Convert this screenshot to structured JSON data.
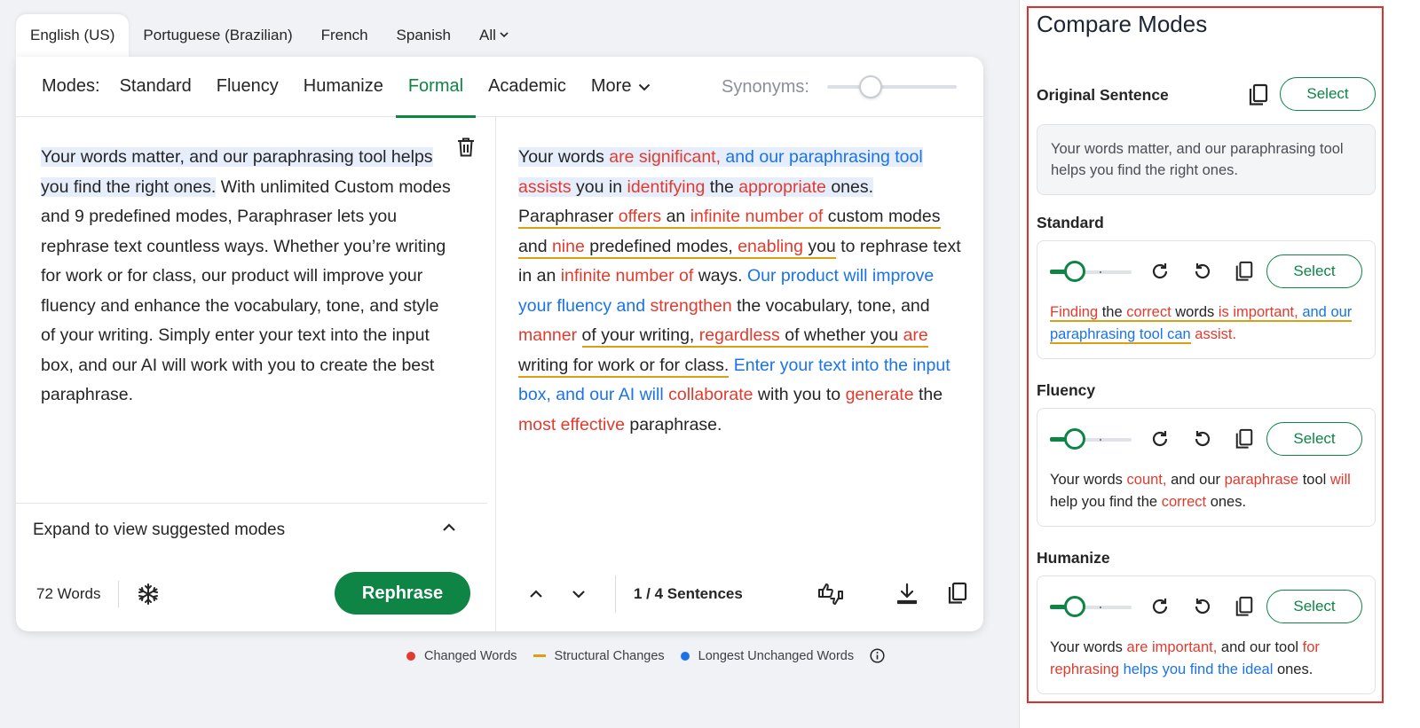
{
  "languages": [
    {
      "label": "English (US)",
      "active": true
    },
    {
      "label": "Portuguese (Brazilian)"
    },
    {
      "label": "French"
    },
    {
      "label": "Spanish"
    },
    {
      "label": "All"
    }
  ],
  "modes": {
    "label": "Modes:",
    "items": [
      "Standard",
      "Fluency",
      "Humanize",
      "Formal",
      "Academic",
      "More"
    ],
    "active": "Formal",
    "synonyms_label": "Synonyms:"
  },
  "input": {
    "sentence1": "Your words matter, and our paraphrasing tool helps you find the right ones.",
    "rest": " With unlimited Custom modes and 9 predefined modes, Paraphraser lets you rephrase text countless ways. Whether you’re writing for work or for class, our product will improve your fluency and enhance the vocabulary, tone, and style of your writing. Simply enter your text into the input box, and our AI will work with you to create the best paraphrase."
  },
  "output": {
    "segments": [
      {
        "t": "Your words ",
        "c": "n",
        "hl": true
      },
      {
        "t": "are significant,",
        "c": "r",
        "hl": true
      },
      {
        "t": " and our paraphrasing tool",
        "c": "b",
        "hl": true
      },
      {
        "t": " ",
        "c": "n",
        "hl": true
      },
      {
        "t": "assists",
        "c": "r",
        "hl": true
      },
      {
        "t": " you in ",
        "c": "n",
        "hl": true
      },
      {
        "t": "identifying",
        "c": "r",
        "hl": true
      },
      {
        "t": " the ",
        "c": "n",
        "hl": true
      },
      {
        "t": "appropriate",
        "c": "r",
        "hl": true
      },
      {
        "t": " ones. ",
        "c": "n",
        "hl": true
      },
      {
        "t": "Paraphraser ",
        "c": "n",
        "ul": true
      },
      {
        "t": "offers",
        "c": "r",
        "ul": true
      },
      {
        "t": " an ",
        "c": "n",
        "ul": true
      },
      {
        "t": "infinite number of",
        "c": "r",
        "ul": true
      },
      {
        "t": " custom modes and ",
        "c": "n",
        "ul": true
      },
      {
        "t": "nine",
        "c": "r",
        "ul": true
      },
      {
        "t": " predefined modes, ",
        "c": "n",
        "ul": true
      },
      {
        "t": "enabling",
        "c": "r",
        "ul": true
      },
      {
        "t": " you",
        "c": "n",
        "ul": true
      },
      {
        "t": " to rephrase text in an ",
        "c": "n"
      },
      {
        "t": "infinite number of",
        "c": "r"
      },
      {
        "t": " ways. ",
        "c": "n"
      },
      {
        "t": "Our product will improve your fluency and",
        "c": "b"
      },
      {
        "t": " ",
        "c": "n"
      },
      {
        "t": "strengthen",
        "c": "r"
      },
      {
        "t": " the vocabulary, tone, and ",
        "c": "n"
      },
      {
        "t": "manner",
        "c": "r"
      },
      {
        "t": " ",
        "c": "n"
      },
      {
        "t": "of your writing, ",
        "c": "n",
        "ul": true
      },
      {
        "t": "regardless",
        "c": "r",
        "ul": true
      },
      {
        "t": " of whether you ",
        "c": "n",
        "ul": true
      },
      {
        "t": "are",
        "c": "r",
        "ul": true
      },
      {
        "t": " writing for work or for class.",
        "c": "n",
        "ul": true
      },
      {
        "t": " ",
        "c": "n"
      },
      {
        "t": "Enter your text into the input box, and our AI will",
        "c": "b"
      },
      {
        "t": " ",
        "c": "n"
      },
      {
        "t": "collaborate",
        "c": "r"
      },
      {
        "t": " with you to ",
        "c": "n"
      },
      {
        "t": "generate",
        "c": "r"
      },
      {
        "t": " the ",
        "c": "n"
      },
      {
        "t": "most effective",
        "c": "r"
      },
      {
        "t": " paraphrase.",
        "c": "n"
      }
    ]
  },
  "expand_label": "Expand to view suggested modes",
  "word_count": "72 Words",
  "rephrase_label": "Rephrase",
  "sentence_count": "1 / 4 Sentences",
  "legend": {
    "changed": "Changed Words",
    "structural": "Structural Changes",
    "unchanged": "Longest Unchanged Words"
  },
  "colors": {
    "brand_green": "#0e8445",
    "changed_red": "#e23b2e",
    "unchanged_blue": "#1a73e8",
    "structural_gold": "#d9a112"
  },
  "compare": {
    "title": "Compare Modes",
    "original_label": "Original Sentence",
    "select_label": "Select",
    "original_text": "Your words matter, and our paraphrasing tool helps you find the right ones.",
    "modes": [
      {
        "name": "Standard",
        "segments": [
          {
            "t": "Finding",
            "c": "r",
            "ul": true
          },
          {
            "t": " the ",
            "c": "n",
            "ul": true
          },
          {
            "t": "correct",
            "c": "r",
            "ul": true
          },
          {
            "t": " words ",
            "c": "n",
            "ul": true
          },
          {
            "t": "is important,",
            "c": "r",
            "ul": true
          },
          {
            "t": " and",
            "c": "b",
            "ul": true
          },
          {
            "t": " our paraphrasing tool",
            "c": "b",
            "ul": true
          },
          {
            "t": " ",
            "c": "n",
            "ul": true
          },
          {
            "t": "can",
            "c": "b",
            "ul": true
          },
          {
            "t": " assist.",
            "c": "r"
          }
        ]
      },
      {
        "name": "Fluency",
        "segments": [
          {
            "t": "Your words ",
            "c": "n"
          },
          {
            "t": "count,",
            "c": "r"
          },
          {
            "t": " and our ",
            "c": "n"
          },
          {
            "t": "paraphrase",
            "c": "r"
          },
          {
            "t": " tool ",
            "c": "n"
          },
          {
            "t": "will",
            "c": "r"
          },
          {
            "t": " help you find the ",
            "c": "n"
          },
          {
            "t": "correct",
            "c": "r"
          },
          {
            "t": " ones.",
            "c": "n"
          }
        ]
      },
      {
        "name": "Humanize",
        "segments": [
          {
            "t": "Your words ",
            "c": "n"
          },
          {
            "t": "are important,",
            "c": "r"
          },
          {
            "t": " and our tool ",
            "c": "n"
          },
          {
            "t": "for rephrasing",
            "c": "r"
          },
          {
            "t": " ",
            "c": "n"
          },
          {
            "t": "helps you find the",
            "c": "b"
          },
          {
            "t": " ",
            "c": "n"
          },
          {
            "t": "ideal",
            "c": "b"
          },
          {
            "t": " ones.",
            "c": "n"
          }
        ]
      }
    ]
  }
}
